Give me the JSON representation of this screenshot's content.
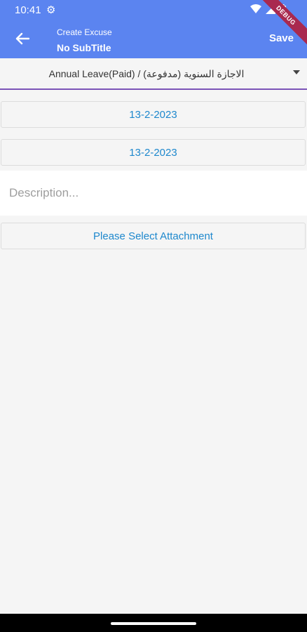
{
  "status_bar": {
    "time": "10:41",
    "gear_icon": "settings-icon",
    "icons": [
      "wifi-icon",
      "signal-icon",
      "battery-icon"
    ]
  },
  "app_bar": {
    "back_icon": "arrow-left-icon",
    "title": "Create Excuse",
    "subtitle": "No SubTitle",
    "save_label": "Save",
    "debug_label": "DEBUG"
  },
  "form": {
    "leave_type": "Annual Leave(Paid) / الاجازة السنوية (مدفوعة)",
    "from_date": "13-2-2023",
    "to_date": "13-2-2023",
    "description_placeholder": "Description...",
    "attachment_label": "Please Select Attachment"
  },
  "colors": {
    "appbar": "#5b84f0",
    "accent_text": "#1e88cd",
    "underline": "#7b54b8",
    "debug": "#a9294f"
  }
}
